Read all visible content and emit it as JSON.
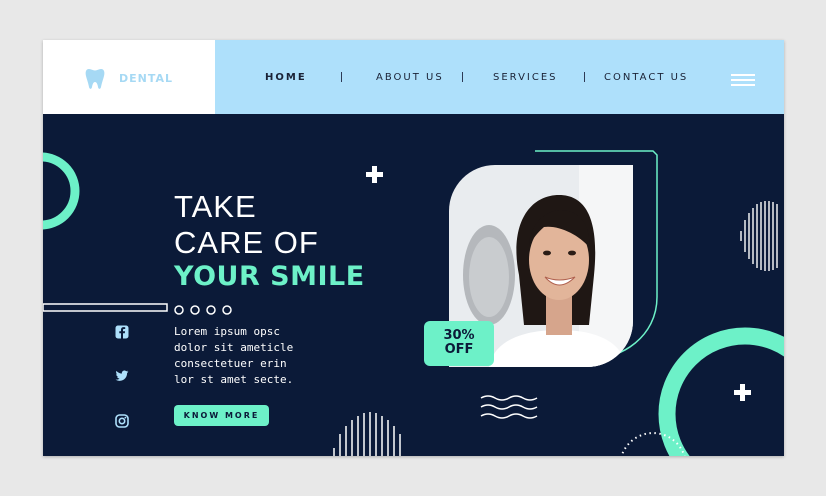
{
  "brand": {
    "name": "DENTAL",
    "icon": "tooth-icon"
  },
  "nav": {
    "items": [
      {
        "label": "HOME",
        "active": true
      },
      {
        "label": "ABOUT US",
        "active": false
      },
      {
        "label": "SERVICES",
        "active": false
      },
      {
        "label": "CONTACT US",
        "active": false
      }
    ],
    "menu_icon": "hamburger-icon"
  },
  "hero": {
    "line1": "TAKE",
    "line2": "CARE OF",
    "line3": "YOUR SMILE",
    "body_lines": [
      "Lorem ipsum opsc",
      "dolor sit ameticle",
      "consectetuer erin",
      "lor st amet secte."
    ],
    "cta_label": "KNOW MORE"
  },
  "badge": {
    "line1": "30%",
    "line2": "OFF"
  },
  "social": [
    "facebook-icon",
    "twitter-icon",
    "instagram-icon"
  ],
  "colors": {
    "accent": "#6df1c8",
    "navy": "#0b1a38",
    "header_blue": "#aee0fb",
    "logo_blue": "#a6d9f4"
  }
}
